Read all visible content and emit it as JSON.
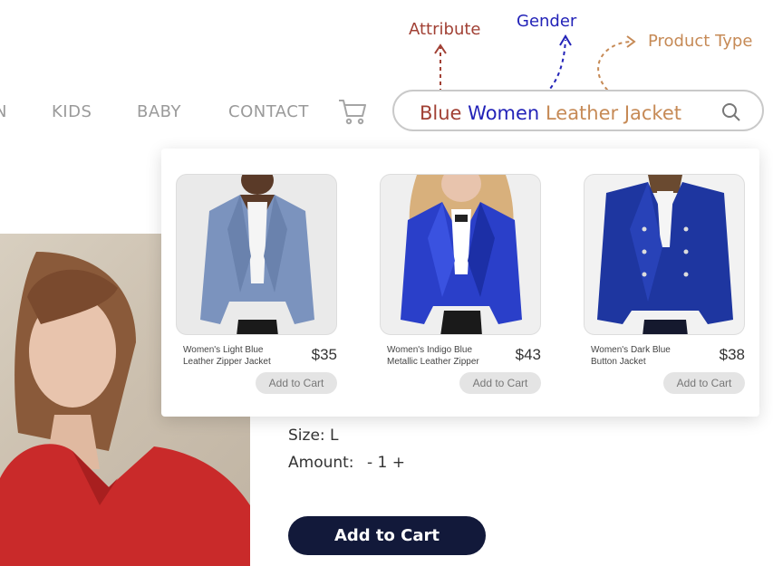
{
  "nav": {
    "items": [
      {
        "label": "N"
      },
      {
        "label": "KIDS"
      },
      {
        "label": "BABY"
      },
      {
        "label": "CONTACT"
      }
    ],
    "cart_icon": "shopping-cart-icon"
  },
  "search": {
    "query_parts": {
      "attribute": "Blue",
      "gender": "Women",
      "product_type": "Leather Jacket"
    },
    "icon": "search-icon"
  },
  "annotations": {
    "attribute": "Attribute",
    "gender": "Gender",
    "product_type": "Product Type"
  },
  "results": [
    {
      "name": "Women's Light Blue Leather Zipper Jacket",
      "price": "$35",
      "button": "Add to Cart",
      "jacket_color": "#7b93be"
    },
    {
      "name": "Women's Indigo Blue Metallic Leather Zipper",
      "price": "$43",
      "button": "Add to Cart",
      "jacket_color": "#2a3fc9"
    },
    {
      "name": "Women's Dark Blue Button Jacket",
      "price": "$38",
      "button": "Add to Cart",
      "jacket_color": "#1e36a0"
    }
  ],
  "product": {
    "size_label": "Size: L",
    "amount_label": "Amount:",
    "amount_control": "- 1 +",
    "add_to_cart": "Add to Cart"
  },
  "colors": {
    "attribute": "#a14034",
    "gender": "#2323b8",
    "product_type": "#c68a56",
    "primary_button": "#12193a",
    "hero_coat": "#c92a2a"
  }
}
